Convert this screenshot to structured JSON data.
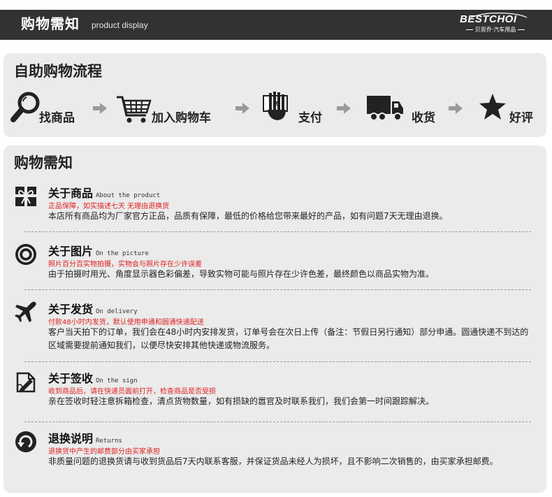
{
  "header": {
    "title": "购物需知",
    "subtitle": "product display",
    "brand_name": "BESTCHOI",
    "brand_tagline": "贝思乔·汽车用品"
  },
  "process": {
    "title": "自助购物流程",
    "steps": [
      {
        "label": "找商品",
        "icon": "magnifier-icon"
      },
      {
        "label": "加入购物车",
        "icon": "shopping-cart-icon"
      },
      {
        "label": "支付",
        "icon": "payment-hand-icon"
      },
      {
        "label": "收货",
        "icon": "delivery-truck-icon"
      },
      {
        "label": "好评",
        "icon": "star-icon"
      }
    ]
  },
  "notice": {
    "title": "购物需知",
    "items": [
      {
        "icon": "gift-icon",
        "title": "关于商品",
        "title_en": "About the product",
        "highlight": "正品保障，如实描述七天 无理由退换货",
        "body": "本店所有商品均为厂家官方正品，品质有保障，最低的价格给您带来最好的产品，如有问题7天无理由退换。"
      },
      {
        "icon": "camera-lens-icon",
        "title": "关于图片",
        "title_en": "On the picture",
        "highlight": "照片百分百实物拍摄，实物会与照片存在少许误差",
        "body": "由于拍摄时用光、角度显示器色彩偏差，导致实物可能与照片存在少许色差，最终颜色以商品实物为准。"
      },
      {
        "icon": "airplane-icon",
        "title": "关于发货",
        "title_en": "On delivery",
        "highlight": "付款48小时内发货，默认使用申通和圆通快递配送",
        "body": "客户当天拍下的订单，我们会在48小时内安排发货，订单号会在次日上传（备注：节假日另行通知）部分申通。圆通快递不到达的区域需要提前通知我们，以便尽快安排其他快递或物流服务。"
      },
      {
        "icon": "sign-pen-icon",
        "title": "关于签收",
        "title_en": "On the sign",
        "highlight": "收到商品后，请在快递员面前打开，检查商品是否受损",
        "body": "亲在签收时轻注意拆箱检查，清点货物数量，如有损缺的嚣官及时联系我们，我们会第一时间跟踪解决。"
      },
      {
        "icon": "return-arrow-icon",
        "title": "退换说明",
        "title_en": "Returns",
        "highlight": "退换货中产生的邮费部分由买家承担",
        "body": "非质量问题的退换货请与收到货品后7天内联系客服，并保证货品未经人为损坏，且不影响二次销售的，由买家承担邮费。"
      }
    ]
  }
}
